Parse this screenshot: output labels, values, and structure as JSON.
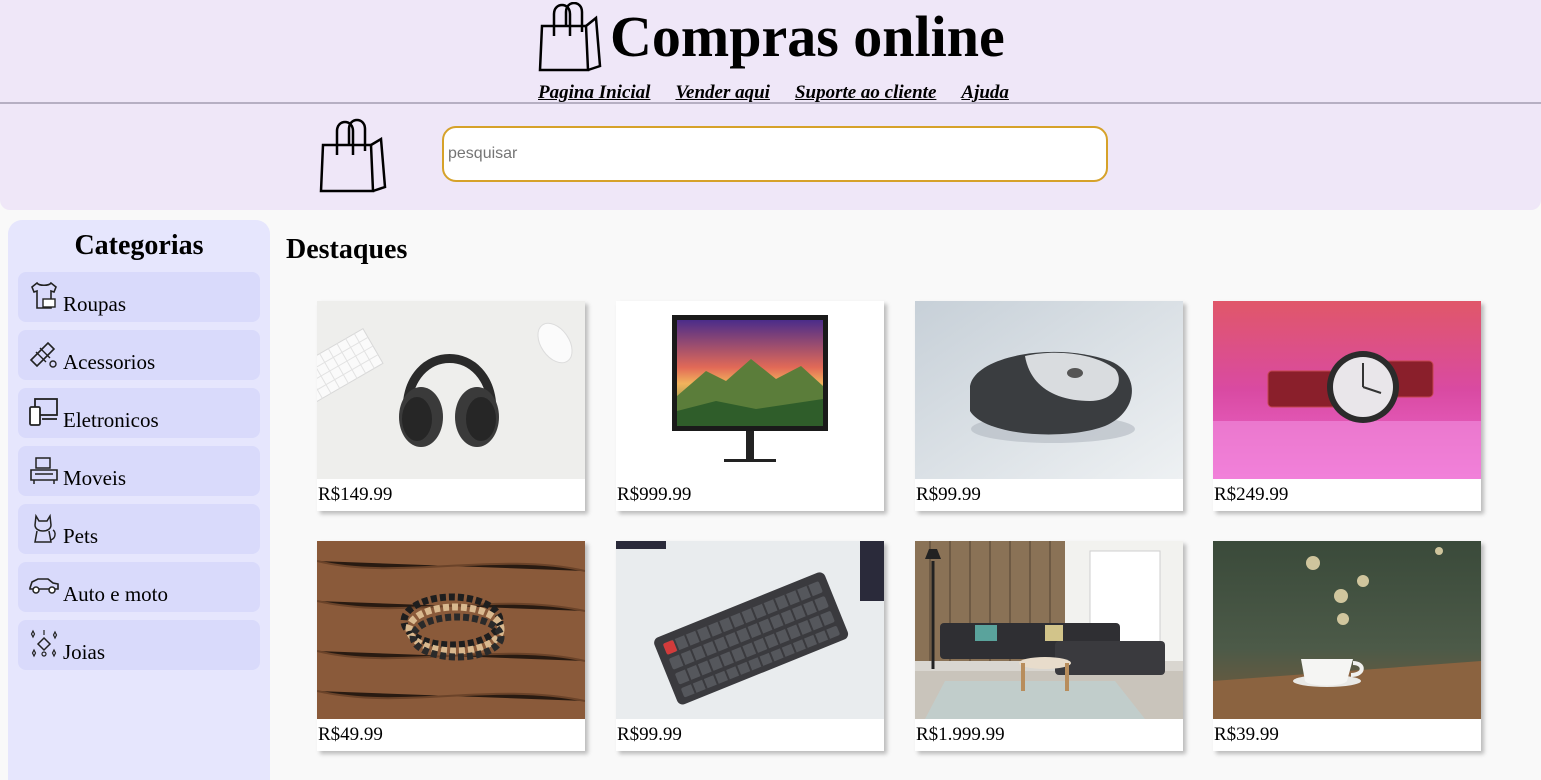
{
  "header": {
    "title": "Compras online",
    "nav": [
      "Pagina Inicial",
      "Vender aqui",
      "Suporte ao cliente",
      "Ajuda"
    ],
    "search": {
      "placeholder": "pesquisar",
      "border_color": "#d6a22a"
    },
    "background": "#efe7f8"
  },
  "sidebar": {
    "title": "Categorias",
    "items": [
      {
        "label": "Roupas",
        "icon": "shirt-icon"
      },
      {
        "label": "Acessorios",
        "icon": "accessories-icon"
      },
      {
        "label": "Eletronicos",
        "icon": "devices-icon"
      },
      {
        "label": "Moveis",
        "icon": "furniture-icon"
      },
      {
        "label": "Pets",
        "icon": "cat-icon"
      },
      {
        "label": "Auto e moto",
        "icon": "car-icon"
      },
      {
        "label": "Joias",
        "icon": "jewel-icon"
      }
    ]
  },
  "main": {
    "title": "Destaques",
    "products": [
      {
        "price": "R$149.99",
        "image": "headphones"
      },
      {
        "price": "R$999.99",
        "image": "monitor"
      },
      {
        "price": "R$99.99",
        "image": "mouse"
      },
      {
        "price": "R$249.99",
        "image": "wristwatch"
      },
      {
        "price": "R$49.99",
        "image": "bracelets"
      },
      {
        "price": "R$99.99",
        "image": "keyboard"
      },
      {
        "price": "R$1.999.99",
        "image": "sofa"
      },
      {
        "price": "R$39.99",
        "image": "coffee-cup"
      }
    ]
  }
}
